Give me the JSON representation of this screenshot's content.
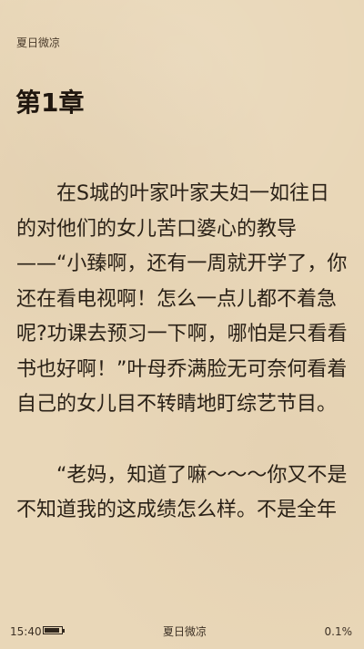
{
  "header": {
    "book_title": "夏日微凉"
  },
  "chapter": {
    "title": "第1章",
    "paragraphs": [
      "在S城的叶家叶家夫妇一如往日的对他们的女儿苦口婆心的教导——“小臻啊，还有一周就开学了，你还在看电视啊！怎么一点儿都不着急呢?功课去预习一下啊，哪怕是只看看书也好啊！”叶母乔满脸无可奈何看着自己的女儿目不转睛地盯综艺节目。",
      "“老妈，知道了嘛～～～你又不是不知道我的这成绩怎么样。不是全年"
    ]
  },
  "footer": {
    "time": "15:40",
    "battery_level": 0.9,
    "book_title": "夏日微凉",
    "progress": "0.1%"
  },
  "icons": {
    "battery": "battery-icon"
  }
}
